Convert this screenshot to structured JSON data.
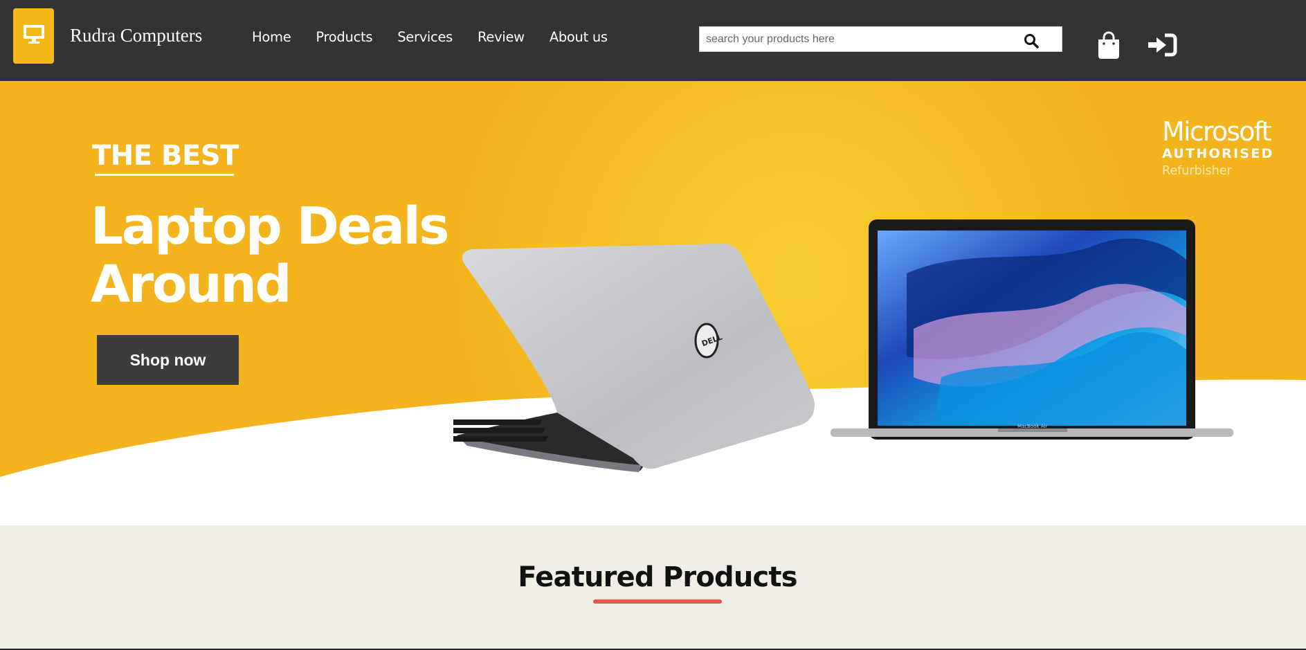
{
  "navbar": {
    "brand": "Rudra Computers",
    "logo_icon": "monitor-icon",
    "links": [
      {
        "label": "Home"
      },
      {
        "label": "Products"
      },
      {
        "label": "Services"
      },
      {
        "label": "Review"
      },
      {
        "label": "About us"
      }
    ],
    "search": {
      "placeholder": "search your products here",
      "value": "",
      "icon": "search-icon"
    },
    "cart_icon": "shopping-bag-icon",
    "login_icon": "sign-in-icon"
  },
  "hero": {
    "eyebrow": "THE BEST",
    "title": "Laptop Deals Around",
    "cta_label": "Shop now",
    "badge": {
      "brand": "Microsoft",
      "line1": "AUTHORISED",
      "line2": "Refurbisher"
    },
    "laptop_logo": "DELL",
    "laptop_model": "MacBook Air"
  },
  "featured": {
    "title": "Featured Products"
  },
  "colors": {
    "navbar_bg": "#333333",
    "accent_yellow": "#f5b81b",
    "cta_bg": "#3d3d3d",
    "featured_bg": "#efede4",
    "underline_red": "#e8554a"
  }
}
